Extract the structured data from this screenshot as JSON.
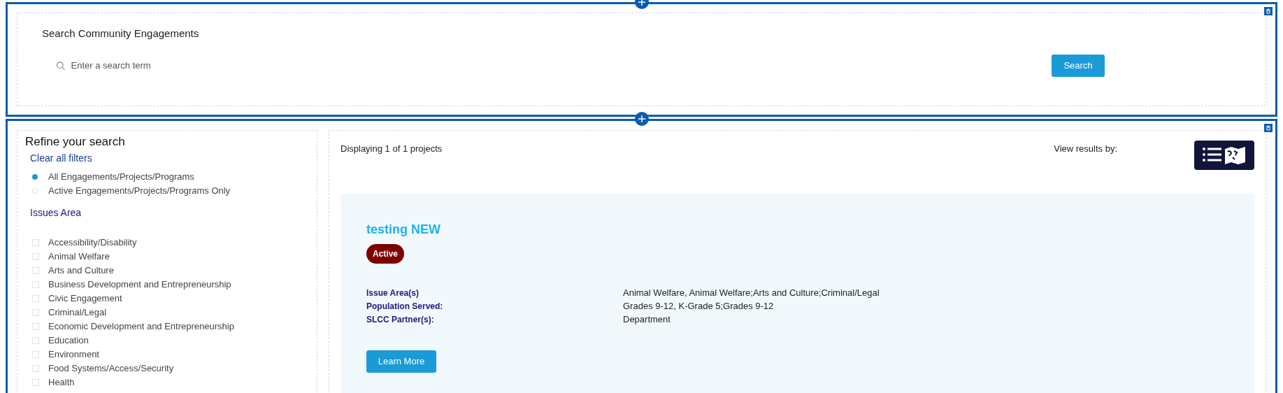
{
  "search_section": {
    "title": "Search Community Engagements",
    "search_field": {
      "placeholder": "Enter a search term"
    },
    "search_button": "Search"
  },
  "filters": {
    "title": "Refine your search",
    "clear_link": "Clear all filters",
    "status_options": [
      {
        "label": "All Engagements/Projects/Programs",
        "selected": true
      },
      {
        "label": "Active Engagements/Projects/Programs Only",
        "selected": false
      }
    ],
    "issues_heading": "Issues Area",
    "issues": [
      {
        "label": "Accessibility/Disability",
        "checked": false
      },
      {
        "label": "Animal Welfare",
        "checked": false
      },
      {
        "label": "Arts and Culture",
        "checked": false
      },
      {
        "label": "Business Development and Entrepreneurship",
        "checked": false
      },
      {
        "label": "Civic Engagement",
        "checked": false
      },
      {
        "label": "Criminal/Legal",
        "checked": false
      },
      {
        "label": "Economic Development and Entrepreneurship",
        "checked": false
      },
      {
        "label": "Education",
        "checked": false
      },
      {
        "label": "Environment",
        "checked": false
      },
      {
        "label": "Food Systems/Access/Security",
        "checked": false
      },
      {
        "label": "Health",
        "checked": false
      }
    ]
  },
  "results": {
    "count_text": "Displaying 1 of 1 projects",
    "view_label": "View results by:",
    "projects": [
      {
        "title": "testing NEW",
        "status": "Active",
        "details": [
          {
            "label": "Issue Area(s)",
            "value": "Animal Welfare, Animal Welfare;Arts and Culture;Criminal/Legal"
          },
          {
            "label": "Population Served:",
            "value": "Grades 9-12, K-Grade 5;Grades 9-12"
          },
          {
            "label": "SLCC Partner(s):",
            "value": "Department"
          }
        ],
        "button": "Learn More"
      }
    ]
  }
}
